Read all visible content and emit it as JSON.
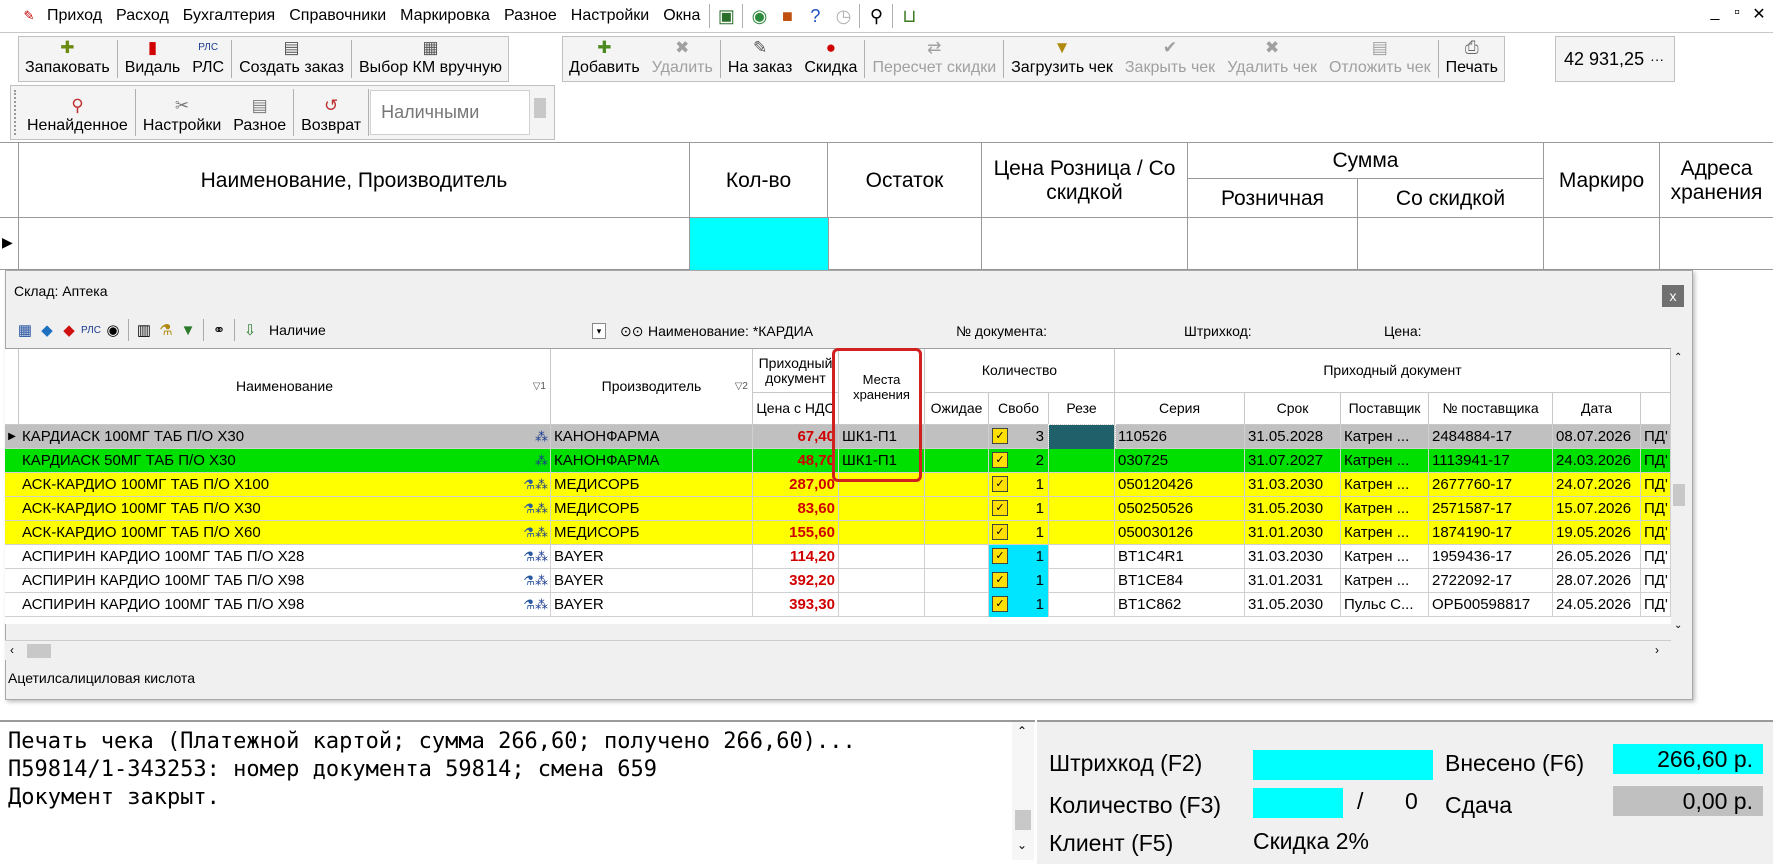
{
  "menu": {
    "items": [
      "Приход",
      "Расход",
      "Бухгалтерия",
      "Справочники",
      "Маркировка",
      "Разное",
      "Настройки",
      "Окна"
    ],
    "window_controls": [
      "_",
      "▫",
      "✕"
    ]
  },
  "toolbar1": {
    "pack": "Запаковать",
    "vidal": "Видаль",
    "rls": "РЛС",
    "create_order": "Создать заказ",
    "select_km": "Выбор КМ вручную"
  },
  "toolbar2": {
    "add": "Добавить",
    "delete": "Удалить",
    "to_order": "На заказ",
    "discount": "Скидка",
    "recalc": "Пересчет скидки",
    "load_check": "Загрузить чек",
    "close_check": "Закрыть чек",
    "delete_check": "Удалить чек",
    "postpone_check": "Отложить чек",
    "print": "Печать"
  },
  "total_amount": "42 931,25",
  "total_more": "···",
  "toolbar3": {
    "not_found": "Ненайденное",
    "settings": "Настройки",
    "misc": "Разное",
    "return": "Возврат",
    "payment_mode": "Наличными"
  },
  "main_grid": {
    "col_name": "Наименование, Производитель",
    "col_qty": "Кол-во",
    "col_rest": "Остаток",
    "col_price": "Цена Розница / Со скидкой",
    "col_sum": "Сумма",
    "col_sum_retail": "Розничная",
    "col_sum_discount": "Со скидкой",
    "col_mark": "Маркиро",
    "col_address": "Адреса хранения"
  },
  "dialog": {
    "title": "Склад: Аптека",
    "close": "x",
    "filter_presence": "Наличие",
    "filter_name": "Наименование: *КАРДИА",
    "filter_doc": "№ документа:",
    "filter_barcode": "Штрихкод:",
    "filter_price": "Цена:",
    "headers": {
      "name": "Наименование",
      "name_sort": "▽1",
      "producer": "Производитель",
      "producer_sort": "▽2",
      "incoming_doc": "Приходный документ",
      "price_vat": "Цена с НДС",
      "storage": "Места хранения",
      "quantity": "Количество",
      "expected": "Ожидае",
      "free": "Свобо",
      "reserve": "Резе",
      "incoming_doc2": "Приходный документ",
      "series": "Серия",
      "expiry": "Срок",
      "supplier": "Поставщик",
      "supplier_no": "№ поставщика",
      "date": "Дата"
    },
    "rows": [
      {
        "name": "КАРДИАСК 100МГ ТАБ П/О Х30",
        "producer": "КАНОНФАРМА",
        "price": "67,40",
        "storage": "ШК1-П1",
        "free": "3",
        "series": "110526",
        "expiry": "31.05.2028",
        "supplier": "Катрен ...",
        "supplier_no": "2484884-17",
        "date": "08.07.2026",
        "extra": "ПД'",
        "style": "selected"
      },
      {
        "name": "КАРДИАСК 50МГ ТАБ П/О Х30",
        "producer": "КАНОНФАРМА",
        "price": "48,70",
        "storage": "ШК1-П1",
        "free": "2",
        "series": "030725",
        "expiry": "31.07.2027",
        "supplier": "Катрен ...",
        "supplier_no": "1113941-17",
        "date": "24.03.2026",
        "extra": "ПД'",
        "style": "green"
      },
      {
        "name": "АСК-КАРДИО 100МГ ТАБ П/О Х100",
        "producer": "МЕДИСОРБ",
        "price": "287,00",
        "storage": "",
        "free": "1",
        "series": "050120426",
        "expiry": "31.03.2030",
        "supplier": "Катрен ...",
        "supplier_no": "2677760-17",
        "date": "24.07.2026",
        "extra": "ПД'",
        "style": "yellow"
      },
      {
        "name": "АСК-КАРДИО 100МГ ТАБ П/О Х30",
        "producer": "МЕДИСОРБ",
        "price": "83,60",
        "storage": "",
        "free": "1",
        "series": "050250526",
        "expiry": "31.05.2030",
        "supplier": "Катрен ...",
        "supplier_no": "2571587-17",
        "date": "15.07.2026",
        "extra": "ПД'",
        "style": "yellow"
      },
      {
        "name": "АСК-КАРДИО 100МГ ТАБ П/О Х60",
        "producer": "МЕДИСОРБ",
        "price": "155,60",
        "storage": "",
        "free": "1",
        "series": "050030126",
        "expiry": "31.01.2030",
        "supplier": "Катрен ...",
        "supplier_no": "1874190-17",
        "date": "19.05.2026",
        "extra": "ПД'",
        "style": "yellow"
      },
      {
        "name": "АСПИРИН КАРДИО 100МГ ТАБ П/О Х28",
        "producer": "BAYER",
        "price": "114,20",
        "storage": "",
        "free": "1",
        "series": "BT1C4R1",
        "expiry": "31.03.2030",
        "supplier": "Катрен ...",
        "supplier_no": "1959436-17",
        "date": "26.05.2026",
        "extra": "ПД'",
        "style": "white"
      },
      {
        "name": "АСПИРИН КАРДИО 100МГ ТАБ П/О Х98",
        "producer": "BAYER",
        "price": "392,20",
        "storage": "",
        "free": "1",
        "series": "BT1CE84",
        "expiry": "31.01.2031",
        "supplier": "Катрен ...",
        "supplier_no": "2722092-17",
        "date": "28.07.2026",
        "extra": "ПД'",
        "style": "white"
      },
      {
        "name": "АСПИРИН КАРДИО 100МГ ТАБ П/О Х98",
        "producer": "BAYER",
        "price": "393,30",
        "storage": "",
        "free": "1",
        "series": "BT1C862",
        "expiry": "31.05.2030",
        "supplier": "Пульс С...",
        "supplier_no": "ОРБ00598817",
        "date": "24.05.2026",
        "extra": "ПД'",
        "style": "white"
      }
    ],
    "substance": "Ацетилсалициловая кислота"
  },
  "log": {
    "lines": [
      "Печать чека (Платежной картой; сумма 266,60; получено 266,60)...",
      "П59814/1-343253: номер документа 59814; смена 659",
      "Документ закрыт."
    ]
  },
  "payment": {
    "barcode_label": "Штрихкод (F2)",
    "qty_label": "Количество (F3)",
    "qty_slash": "/",
    "qty_value": "0",
    "client_label": "Клиент (F5)",
    "discount": "Скидка 2%",
    "paid_label": "Внесено (F6)",
    "paid_value": "266,60 р.",
    "change_label": "Сдача",
    "change_value": "0,00 р."
  }
}
